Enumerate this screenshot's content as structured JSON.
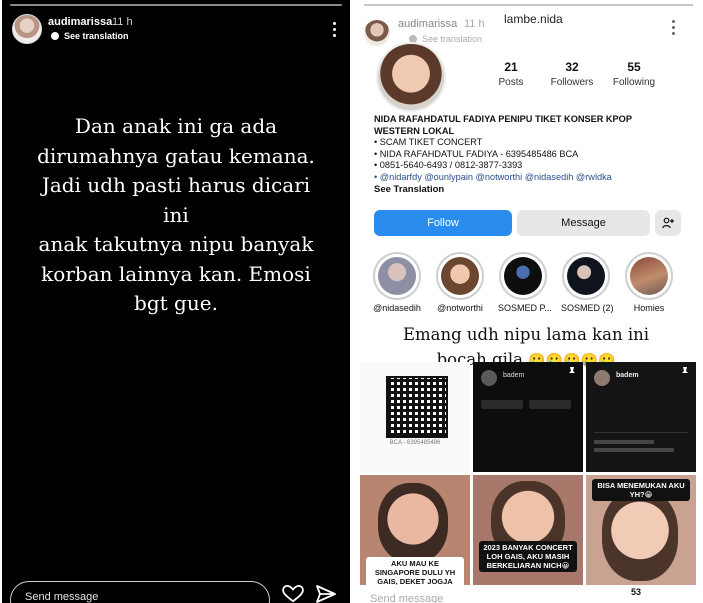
{
  "left_story": {
    "username": "audimarissa",
    "time": "11 h",
    "see_translation": "See translation",
    "text_lines": [
      "Dan anak ini ga ada",
      "dirumahnya gatau kemana.",
      "Jadi udh pasti harus dicari ini",
      "anak takutnya nipu banyak",
      "korban lainnya kan. Emosi",
      "bgt gue."
    ],
    "send_placeholder": "Send message"
  },
  "right_story": {
    "username": "audimarissa",
    "time": "11 h",
    "see_translation": "See translation",
    "profile_name": "lambe.nida",
    "stats": [
      {
        "num": "21",
        "label": "Posts"
      },
      {
        "num": "32",
        "label": "Followers"
      },
      {
        "num": "55",
        "label": "Following"
      }
    ],
    "bio": {
      "title_line1": "NIDA RAFAHDATUL FADIYA PENIPU TIKET KONSER KPOP",
      "title_line2": "WESTERN LOKAL",
      "lines": [
        "• SCAM TIKET CONCERT",
        "• NIDA RAFAHDATUL FADIYA - 6395485486 BCA",
        "• 0851-5640-6493 / 0812-3877-3393"
      ],
      "links": "• @nidarfdy @ounlypain @notworthi @nidasedih @rwldka",
      "see_translation": "See Translation"
    },
    "buttons": {
      "follow": "Follow",
      "message": "Message"
    },
    "highlights": [
      {
        "label": "@nidasedih"
      },
      {
        "label": "@notworthi"
      },
      {
        "label": "SOSMED P..."
      },
      {
        "label": "SOSMED (2)"
      },
      {
        "label": "Homies"
      }
    ],
    "overlay_line1": "Emang udh nipu lama kan ini",
    "overlay_line2": "bocah gila",
    "overlay_emoji": "🥲🥲🥲🥲🥲",
    "grid": {
      "qr_caption": "BCA - 6395485486",
      "post2_name": "badem",
      "post3_name": "badem",
      "caption4": "AKU MAU KE SINGAPORE DULU YH GAIS, DEKET JOGJA KOK😁",
      "caption5": "2023 BANYAK CONCERT LOH GAIS, AKU MASIH BERKELIARAN NICH😀",
      "caption6": "BISA MENEMUKAN AKU YH?😁"
    },
    "send_placeholder": "Send message",
    "count": "53"
  }
}
